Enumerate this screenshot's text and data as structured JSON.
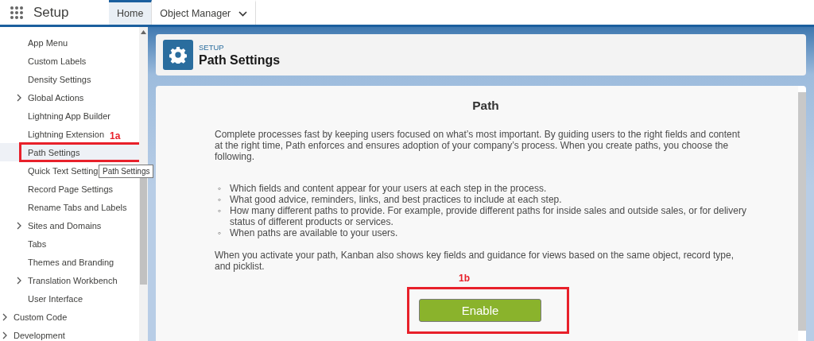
{
  "app": {
    "title": "Setup"
  },
  "tabs": [
    {
      "label": "Home",
      "selected": true,
      "kind": "plain"
    },
    {
      "label": "Object Manager",
      "selected": false,
      "kind": "dropdown"
    }
  ],
  "sidebar": {
    "items": [
      {
        "label": "App Menu",
        "expandable": false,
        "selected": false
      },
      {
        "label": "Custom Labels",
        "expandable": false,
        "selected": false
      },
      {
        "label": "Density Settings",
        "expandable": false,
        "selected": false
      },
      {
        "label": "Global Actions",
        "expandable": true,
        "selected": false
      },
      {
        "label": "Lightning App Builder",
        "expandable": false,
        "selected": false
      },
      {
        "label": "Lightning Extension",
        "expandable": false,
        "selected": false
      },
      {
        "label": "Path Settings",
        "expandable": false,
        "selected": true
      },
      {
        "label": "Quick Text Setting",
        "expandable": false,
        "selected": false
      },
      {
        "label": "Record Page Settings",
        "expandable": false,
        "selected": false
      },
      {
        "label": "Rename Tabs and Labels",
        "expandable": false,
        "selected": false
      },
      {
        "label": "Sites and Domains",
        "expandable": true,
        "selected": false
      },
      {
        "label": "Tabs",
        "expandable": false,
        "selected": false
      },
      {
        "label": "Themes and Branding",
        "expandable": false,
        "selected": false
      },
      {
        "label": "Translation Workbench",
        "expandable": true,
        "selected": false
      },
      {
        "label": "User Interface",
        "expandable": false,
        "selected": false
      }
    ],
    "sections": [
      {
        "label": "Custom Code",
        "expandable": true
      },
      {
        "label": "Development",
        "expandable": true
      }
    ]
  },
  "tooltip": {
    "text": "Path Settings"
  },
  "annotations": [
    {
      "label": "1a"
    },
    {
      "label": "1b"
    }
  ],
  "page_header": {
    "eyebrow": "SETUP",
    "title": "Path Settings"
  },
  "content": {
    "heading": "Path",
    "intro": "Complete processes fast by keeping users focused on what’s most important. By guiding users to the right fields and content at the right time, Path enforces and ensures adoption of your company’s process. When you create paths, you choose the following.",
    "bullets": [
      {
        "marker": "◦",
        "text": "Which fields and content appear for your users at each step in the process."
      },
      {
        "marker": "◦",
        "text": "What good advice, reminders, links, and best practices to include at each step."
      },
      {
        "marker": "◦",
        "text": "How many different paths to provide. For example, provide different paths for inside sales and outside sales, or for delivery status of different products or services."
      },
      {
        "marker": "◦",
        "text": "When paths are available to your users."
      }
    ],
    "outro": "When you activate your path, Kanban also shows key fields and guidance for views based on the same object, record type, and picklist.",
    "button": "Enable"
  }
}
